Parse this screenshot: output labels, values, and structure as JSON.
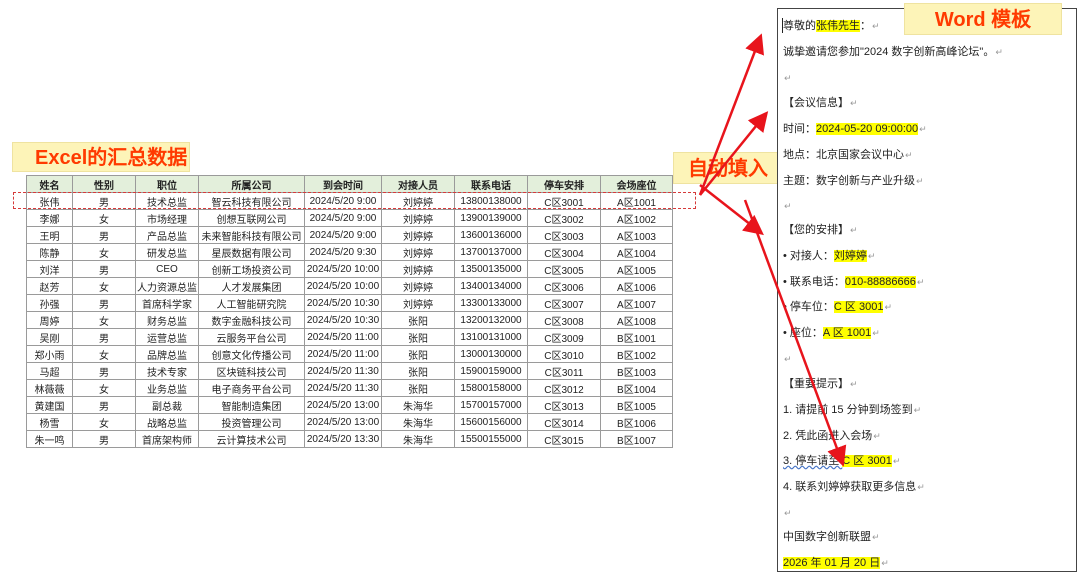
{
  "labels": {
    "excel": "Excel的汇总数据",
    "auto": "自动填入",
    "word": "Word 模板"
  },
  "table": {
    "headers": [
      "姓名",
      "性别",
      "职位",
      "所属公司",
      "到会时间",
      "对接人员",
      "联系电话",
      "停车安排",
      "会场座位"
    ],
    "rows": [
      [
        "张伟",
        "男",
        "技术总监",
        "智云科技有限公司",
        "2024/5/20 9:00",
        "刘婷婷",
        "13800138000",
        "C区3001",
        "A区1001"
      ],
      [
        "李娜",
        "女",
        "市场经理",
        "创想互联网公司",
        "2024/5/20 9:00",
        "刘婷婷",
        "13900139000",
        "C区3002",
        "A区1002"
      ],
      [
        "王明",
        "男",
        "产品总监",
        "未来智能科技有限公司",
        "2024/5/20 9:00",
        "刘婷婷",
        "13600136000",
        "C区3003",
        "A区1003"
      ],
      [
        "陈静",
        "女",
        "研发总监",
        "星辰数据有限公司",
        "2024/5/20 9:30",
        "刘婷婷",
        "13700137000",
        "C区3004",
        "A区1004"
      ],
      [
        "刘洋",
        "男",
        "CEO",
        "创新工场投资公司",
        "2024/5/20 10:00",
        "刘婷婷",
        "13500135000",
        "C区3005",
        "A区1005"
      ],
      [
        "赵芳",
        "女",
        "人力资源总监",
        "人才发展集团",
        "2024/5/20 10:00",
        "刘婷婷",
        "13400134000",
        "C区3006",
        "A区1006"
      ],
      [
        "孙强",
        "男",
        "首席科学家",
        "人工智能研究院",
        "2024/5/20 10:30",
        "刘婷婷",
        "13300133000",
        "C区3007",
        "A区1007"
      ],
      [
        "周婷",
        "女",
        "财务总监",
        "数字金融科技公司",
        "2024/5/20 10:30",
        "张阳",
        "13200132000",
        "C区3008",
        "A区1008"
      ],
      [
        "吴刚",
        "男",
        "运营总监",
        "云服务平台公司",
        "2024/5/20 11:00",
        "张阳",
        "13100131000",
        "C区3009",
        "B区1001"
      ],
      [
        "郑小雨",
        "女",
        "品牌总监",
        "创意文化传播公司",
        "2024/5/20 11:00",
        "张阳",
        "13000130000",
        "C区3010",
        "B区1002"
      ],
      [
        "马超",
        "男",
        "技术专家",
        "区块链科技公司",
        "2024/5/20 11:30",
        "张阳",
        "15900159000",
        "C区3011",
        "B区1003"
      ],
      [
        "林薇薇",
        "女",
        "业务总监",
        "电子商务平台公司",
        "2024/5/20 11:30",
        "张阳",
        "15800158000",
        "C区3012",
        "B区1004"
      ],
      [
        "黄建国",
        "男",
        "副总裁",
        "智能制造集团",
        "2024/5/20 13:00",
        "朱海华",
        "15700157000",
        "C区3013",
        "B区1005"
      ],
      [
        "杨雪",
        "女",
        "战略总监",
        "投资管理公司",
        "2024/5/20 13:00",
        "朱海华",
        "15600156000",
        "C区3014",
        "B区1006"
      ],
      [
        "朱一鸣",
        "男",
        "首席架构师",
        "云计算技术公司",
        "2024/5/20 13:30",
        "朱海华",
        "15500155000",
        "C区3015",
        "B区1007"
      ]
    ]
  },
  "doc": {
    "greeting_pre": "尊敬的",
    "greeting_name": "张伟先生",
    "greeting_post": "：",
    "invite": "诚挚邀请您参加\"2024 数字创新高峰论坛\"。",
    "meeting_header": "【会议信息】",
    "time_label": "时间：",
    "time_value": "2024-05-20 09:00:00",
    "place": "地点：北京国家会议中心",
    "topic": "主题：数字创新与产业升级",
    "arrange_header": "【您的安排】",
    "contact_label": "• 对接人：",
    "contact_value": "刘婷婷",
    "phone_label": "• 联系电话：",
    "phone_value": "010-88886666",
    "parking_label": "• 停车位：",
    "parking_value": "C 区 3001",
    "seat_label": "• 座位：",
    "seat_value": "A 区 1001",
    "notice_header": "【重要提示】",
    "notice1": "1. 请提前 15 分钟到场签到",
    "notice2": "2. 凭此函进入会场",
    "notice3_pre": "3. 停车请至 ",
    "notice3_value": "C 区 3001",
    "notice4": "4. 联系刘婷婷获取更多信息",
    "org": "中国数字创新联盟",
    "date": "2026 年 01 月 20 日",
    "para_mark": "↵"
  },
  "colors": {
    "accent": "#ff3a00",
    "label_bg": "#fdf4b8",
    "header_bg": "#e3efdb",
    "highlight": "#ffff00",
    "arrow": "#e8141c"
  }
}
